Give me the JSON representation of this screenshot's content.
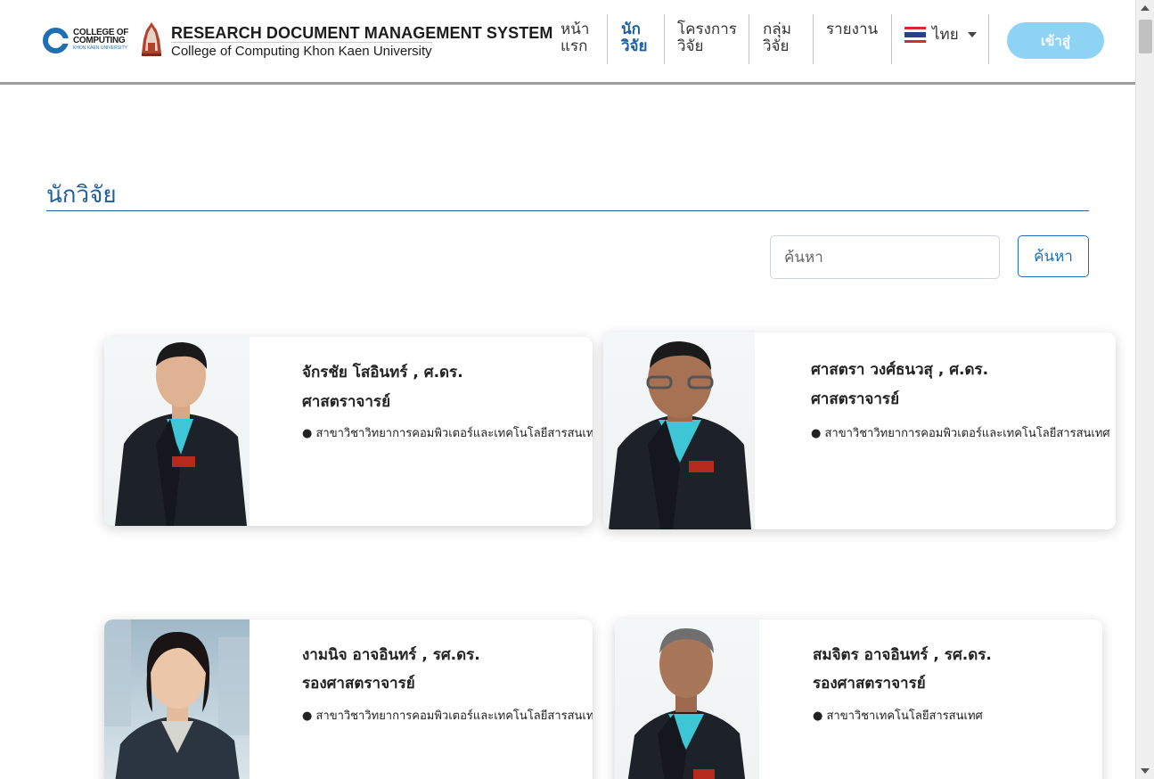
{
  "header": {
    "logo_line1": "COLLEGE OF",
    "logo_line2": "COMPUTING",
    "logo_line3": "KHON KAEN UNIVERSITY",
    "title": "RESEARCH DOCUMENT MANAGEMENT SYSTEM",
    "subtitle": "College of Computing Khon Kaen University",
    "nav": [
      {
        "label": "หน้า\nแรก",
        "active": false
      },
      {
        "label": "นัก\nวิจัย",
        "active": true
      },
      {
        "label": "โครงการ\nวิจัย",
        "active": false
      },
      {
        "label": "กลุ่ม\nวิจัย",
        "active": false
      },
      {
        "label": "รายงาน",
        "active": false
      }
    ],
    "language": "ไทย",
    "login_label": "เข้าสู่"
  },
  "page": {
    "title": "นักวิจัย",
    "search_placeholder": "ค้นหา",
    "search_button": "ค้นหา"
  },
  "researchers": [
    {
      "name": "จักรชัย โสอินทร์ , ศ.ดร.",
      "position": "ศาสตราจารย์",
      "department": "● สาขาวิชาวิทยาการคอมพิวเตอร์และเทคโนโลยีสารสนเทศ"
    },
    {
      "name": "ศาสตรา วงศ์ธนวสุ , ศ.ดร.",
      "position": "ศาสตราจารย์",
      "department": "● สาขาวิชาวิทยาการคอมพิวเตอร์และเทคโนโลยีสารสนเทศ"
    },
    {
      "name": "งามนิจ อาจอินทร์ , รศ.ดร.",
      "position": "รองศาสตราจารย์",
      "department": "● สาขาวิชาวิทยาการคอมพิวเตอร์และเทคโนโลยีสารสนเทศ"
    },
    {
      "name": "สมจิตร อาจอินทร์ , รศ.ดร.",
      "position": "รองศาสตราจารย์",
      "department": "● สาขาวิชาเทคโนโลยีสารสนเทศ"
    }
  ],
  "colors": {
    "primary": "#1e5e9c",
    "login_button": "#8fd3f4",
    "search_border": "#1f6fb5"
  }
}
